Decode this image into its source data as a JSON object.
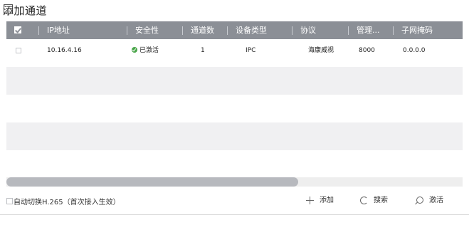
{
  "dialog": {
    "title": "添加通道"
  },
  "table": {
    "columns": [
      "IP地址",
      "安全性",
      "通道数",
      "设备类型",
      "协议",
      "管理...",
      "子网掩码"
    ],
    "rows": [
      {
        "ip": "10.16.4.16",
        "security": "已激活",
        "channels": "1",
        "device_type": "IPC",
        "protocol": "海康威视",
        "port": "8000",
        "subnet_mask": "0.0.0.0"
      }
    ]
  },
  "footer": {
    "auto_switch_label": "自动切换H.265（首次接入生效）",
    "add_label": "添加",
    "search_label": "搜索",
    "activate_label": "激活"
  },
  "colors": {
    "header_bg": "#8b8f96",
    "alt_row_bg": "#f0f0f2",
    "active_status": "#4aa64a",
    "scroll_thumb": "#b7b9be"
  },
  "icons": [
    "checkbox-icon",
    "check-circle-icon",
    "plus-icon",
    "refresh-icon",
    "search-icon"
  ]
}
